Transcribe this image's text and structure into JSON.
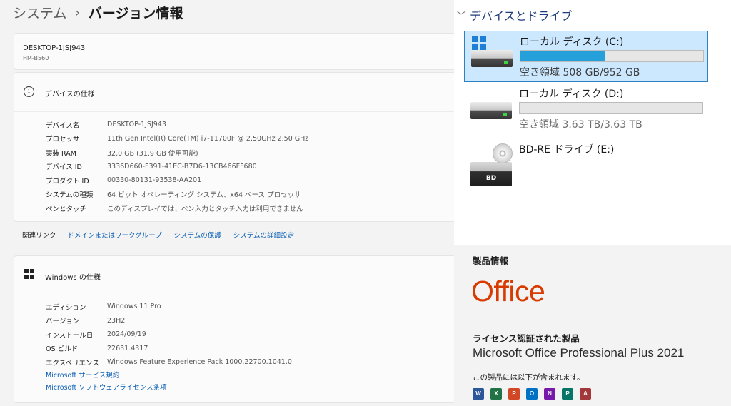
{
  "breadcrumb": {
    "parent": "システム",
    "separator": "›",
    "current": "バージョン情報"
  },
  "device": {
    "name": "DESKTOP-1JSJ943",
    "model": "HM-B560"
  },
  "device_spec": {
    "title": "デバイスの仕様",
    "icon": "info-icon",
    "rows": [
      {
        "label": "デバイス名",
        "value": "DESKTOP-1JSJ943"
      },
      {
        "label": "プロセッサ",
        "value": "11th Gen Intel(R) Core(TM) i7-11700F @ 2.50GHz   2.50 GHz"
      },
      {
        "label": "実装 RAM",
        "value": "32.0 GB (31.9 GB 使用可能)"
      },
      {
        "label": "デバイス ID",
        "value": "3336D660-F391-41EC-B7D6-13CB466FF680"
      },
      {
        "label": "プロダクト ID",
        "value": "00330-80131-93538-AA201"
      },
      {
        "label": "システムの種類",
        "value": "64 ビット オペレーティング システム、x64 ベース プロセッサ"
      },
      {
        "label": "ペンとタッチ",
        "value": "このディスプレイでは、ペン入力とタッチ入力は利用できません"
      }
    ]
  },
  "related_links": {
    "label": "関連リンク",
    "links": [
      "ドメインまたはワークグループ",
      "システムの保護",
      "システムの詳細設定"
    ]
  },
  "windows_spec": {
    "title": "Windows の仕様",
    "icon": "windows-logo-icon",
    "rows": [
      {
        "label": "エディション",
        "value": "Windows 11 Pro"
      },
      {
        "label": "バージョン",
        "value": "23H2"
      },
      {
        "label": "インストール日",
        "value": "2024/09/19"
      },
      {
        "label": "OS ビルド",
        "value": "22631.4317"
      },
      {
        "label": "エクスペリエンス",
        "value": "Windows Feature Experience Pack 1000.22700.1041.0"
      }
    ],
    "links": [
      "Microsoft サービス規約",
      "Microsoft ソフトウェアライセンス条項"
    ]
  },
  "drives": {
    "title": "デバイスとドライブ",
    "items": [
      {
        "name": "ローカル ディスク (C:)",
        "free": "空き領域 508 GB/952 GB",
        "used_fraction": 0.466,
        "selected": true,
        "icon": "windows-drive-icon"
      },
      {
        "name": "ローカル ディスク (D:)",
        "free": "空き領域 3.63 TB/3.63 TB",
        "used_fraction": 0.0,
        "selected": false,
        "icon": "hard-drive-icon"
      },
      {
        "name": "BD-RE ドライブ (E:)",
        "badge": "BD",
        "icon": "bluray-drive-icon"
      }
    ]
  },
  "office": {
    "product_info_label": "製品情報",
    "logo_text": "Office",
    "licensed_label": "ライセンス認証された製品",
    "product_name": "Microsoft Office Professional Plus 2021",
    "includes_label": "この製品には以下が含まれます。",
    "apps": [
      {
        "letter": "W",
        "name": "word-icon",
        "color": "#2b579a"
      },
      {
        "letter": "X",
        "name": "excel-icon",
        "color": "#217346"
      },
      {
        "letter": "P",
        "name": "powerpoint-icon",
        "color": "#d24726"
      },
      {
        "letter": "O",
        "name": "outlook-icon",
        "color": "#0072c6"
      },
      {
        "letter": "N",
        "name": "onenote-icon",
        "color": "#7719aa"
      },
      {
        "letter": "P",
        "name": "publisher-icon",
        "color": "#077568"
      },
      {
        "letter": "A",
        "name": "access-icon",
        "color": "#a4373a"
      }
    ],
    "accent_color": "#d83b01"
  }
}
